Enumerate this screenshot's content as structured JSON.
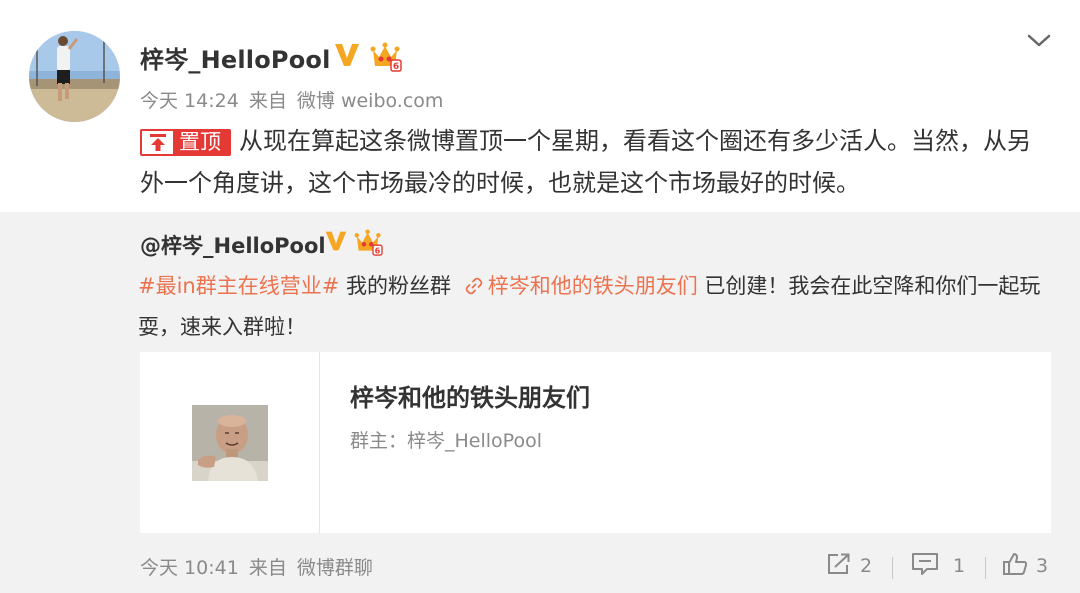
{
  "post": {
    "username": "梓岑_HelloPool",
    "meta": {
      "time": "今天 14:24",
      "from": "来自",
      "source": "微博 weibo.com"
    },
    "pin_label": "置顶",
    "text": "从现在算起这条微博置顶一个星期，看看这个圈还有多少活人。当然，从另外一个角度讲，这个市场最冷的时候，也就是这个市场最好的时候。",
    "colors": {
      "pin": "#e53935",
      "verified": "#f5a623"
    },
    "icons": {
      "collapse": "chevron-down-icon",
      "verified": "verified-v-icon",
      "crown": "vip-crown-icon",
      "pin": "pin-top-icon"
    }
  },
  "repost": {
    "username": "@梓岑_HelloPool",
    "topic": "#最in群主在线营业#",
    "text_before_link": " 我的粉丝群 ",
    "link_text": "梓岑和他的铁头朋友们",
    "text_after_link": " 已创建！我会在此空降和你们一起玩耍，速来入群啦！",
    "colors": {
      "link": "#eb7350"
    },
    "card": {
      "title": "梓岑和他的铁头朋友们",
      "owner": "群主：梓岑_HelloPool"
    }
  },
  "footer": {
    "time": "今天 10:41",
    "from": "来自",
    "source": "微博群聊",
    "actions": {
      "repost_count": "2",
      "comment_count": "1",
      "like_count": "3"
    },
    "icons": {
      "repost": "share-icon",
      "comment": "comment-icon",
      "like": "thumbs-up-icon"
    }
  }
}
